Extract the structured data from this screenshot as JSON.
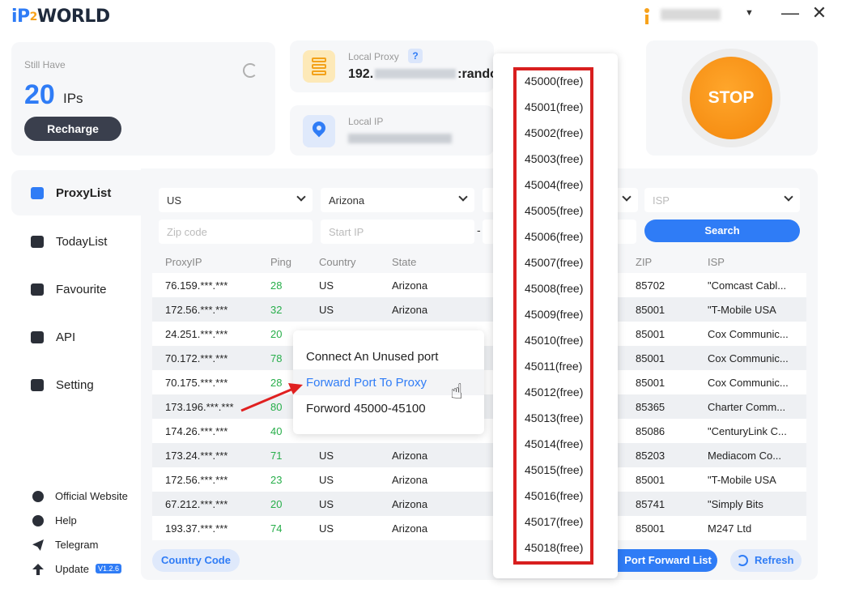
{
  "app": {
    "logo": {
      "ip": "iP",
      "two": "2",
      "world": "WORLD"
    },
    "window": {
      "minimize": "—",
      "close": "✕",
      "user_caret": "▼"
    }
  },
  "colors": {
    "accent": "#2f7cf6",
    "stop": "#f3860b",
    "ping_green": "#27ae4a",
    "highlight_border": "#d81e1e"
  },
  "balance": {
    "label": "Still Have",
    "count": "20",
    "unit": "IPs",
    "recharge_label": "Recharge",
    "refresh_icon": "refresh-icon"
  },
  "local_proxy": {
    "label": "Local Proxy",
    "help": "?",
    "value_prefix": "192.",
    "value_suffix": ":rando"
  },
  "local_ip": {
    "label": "Local IP"
  },
  "stop_button": {
    "label": "STOP"
  },
  "sidebar": {
    "items": [
      {
        "label": "ProxyList",
        "icon": "proxylist-icon"
      },
      {
        "label": "TodayList",
        "icon": "todaylist-icon"
      },
      {
        "label": "Favourite",
        "icon": "star-icon"
      },
      {
        "label": "API",
        "icon": "api-icon"
      },
      {
        "label": "Setting",
        "icon": "gear-icon"
      }
    ],
    "links": [
      {
        "label": "Official Website",
        "icon": "globe-icon"
      },
      {
        "label": "Help",
        "icon": "bulb-icon"
      },
      {
        "label": "Telegram",
        "icon": "telegram-icon"
      },
      {
        "label": "Update",
        "icon": "upload-icon",
        "version": "V1.2.6"
      }
    ]
  },
  "filters": {
    "country": "US",
    "state": "Arizona",
    "isp_placeholder": "ISP",
    "zip_placeholder": "Zip code",
    "start_ip_placeholder": "Start IP",
    "dash": "-",
    "search_label": "Search"
  },
  "table": {
    "headers": [
      "ProxyIP",
      "Ping",
      "Country",
      "State",
      "ZIP",
      "ISP"
    ],
    "rows": [
      {
        "ip": "76.159.***.***",
        "ping": "28",
        "country": "US",
        "state": "Arizona",
        "zip": "85702",
        "isp": "\"Comcast Cabl..."
      },
      {
        "ip": "172.56.***.***",
        "ping": "32",
        "country": "US",
        "state": "Arizona",
        "zip": "85001",
        "isp": "\"T-Mobile USA"
      },
      {
        "ip": "24.251.***.***",
        "ping": "20",
        "country": "",
        "state": "",
        "zip": "85001",
        "isp": "Cox Communic..."
      },
      {
        "ip": "70.172.***.***",
        "ping": "78",
        "country": "",
        "state": "",
        "zip": "85001",
        "isp": "Cox Communic..."
      },
      {
        "ip": "70.175.***.***",
        "ping": "28",
        "country": "",
        "state": "",
        "zip": "85001",
        "isp": "Cox Communic..."
      },
      {
        "ip": "173.196.***.***",
        "ping": "80",
        "country": "",
        "state": "",
        "zip": "85365",
        "isp": "Charter Comm..."
      },
      {
        "ip": "174.26.***.***",
        "ping": "40",
        "country": "",
        "state": "",
        "zip": "85086",
        "isp": "\"CenturyLink C..."
      },
      {
        "ip": "173.24.***.***",
        "ping": "71",
        "country": "US",
        "state": "Arizona",
        "zip": "85203",
        "isp": "Mediacom Co..."
      },
      {
        "ip": "172.56.***.***",
        "ping": "23",
        "country": "US",
        "state": "Arizona",
        "zip": "85001",
        "isp": "\"T-Mobile USA"
      },
      {
        "ip": "67.212.***.***",
        "ping": "20",
        "country": "US",
        "state": "Arizona",
        "zip": "85741",
        "isp": "\"Simply Bits"
      },
      {
        "ip": "193.37.***.***",
        "ping": "74",
        "country": "US",
        "state": "Arizona",
        "zip": "85001",
        "isp": "M247 Ltd"
      }
    ]
  },
  "bottom_bar": {
    "country_code": "Country Code",
    "port_forward_list": "Port Forward List",
    "refresh": "Refresh"
  },
  "context_menu": {
    "items": [
      "Connect An Unused port",
      "Forward Port To Proxy",
      "Forword 45000-45100"
    ],
    "highlighted_index": 1
  },
  "port_dropdown": {
    "items": [
      "45000(free)",
      "45001(free)",
      "45002(free)",
      "45003(free)",
      "45004(free)",
      "45005(free)",
      "45006(free)",
      "45007(free)",
      "45008(free)",
      "45009(free)",
      "45010(free)",
      "45011(free)",
      "45012(free)",
      "45013(free)",
      "45014(free)",
      "45015(free)",
      "45016(free)",
      "45017(free)",
      "45018(free)"
    ]
  }
}
